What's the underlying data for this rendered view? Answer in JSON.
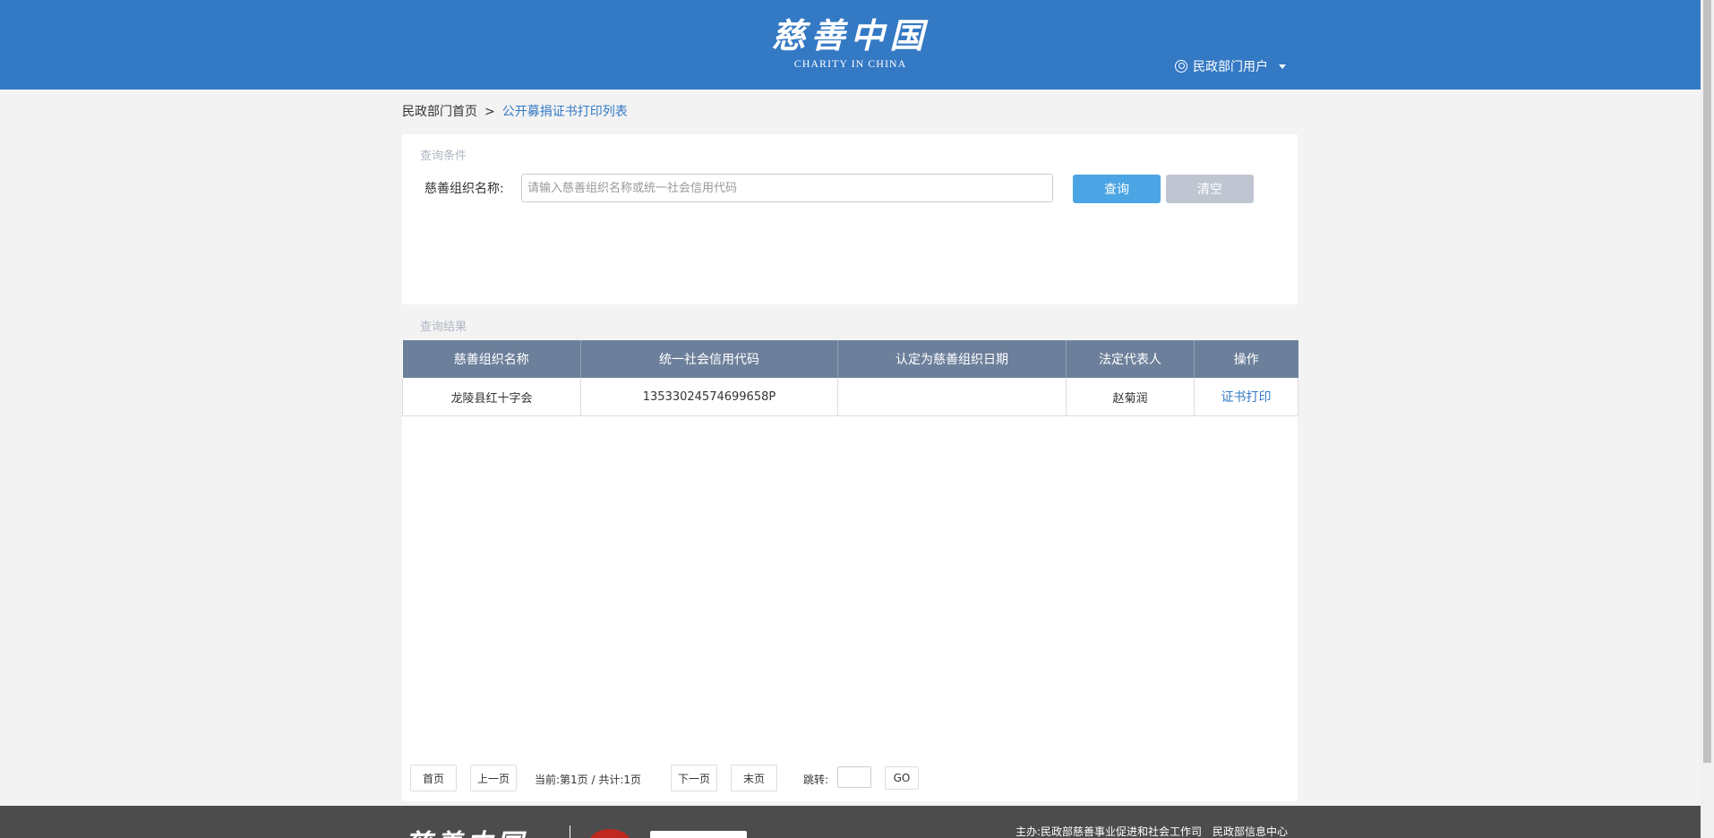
{
  "header": {
    "logo_cn": "慈善中国",
    "logo_en": "CHARITY IN CHINA",
    "user_label": "民政部门用户"
  },
  "breadcrumb": {
    "home": "民政部门首页",
    "separator": ">",
    "current": "公开募捐证书打印列表"
  },
  "query": {
    "title": "查询条件",
    "field_label": "慈善组织名称:",
    "placeholder": "请输入慈善组织名称或统一社会信用代码",
    "search_button": "查询",
    "clear_button": "清空"
  },
  "results": {
    "title": "查询结果",
    "columns": [
      "慈善组织名称",
      "统一社会信用代码",
      "认定为慈善组织日期",
      "法定代表人",
      "操作"
    ],
    "rows": [
      {
        "name": "龙陵县红十字会",
        "credit_code": "13533024574699658P",
        "date": "",
        "legal_rep": "赵菊润",
        "action": "证书打印"
      }
    ]
  },
  "pager": {
    "first": "首页",
    "prev": "上一页",
    "info": "当前:第1页 / 共计:1页",
    "next": "下一页",
    "last": "末页",
    "jump_label": "跳转:",
    "go": "GO"
  },
  "footer": {
    "logo": "慈善中国",
    "sponsor_prefix": "主办:民政部慈善事业促进和社会工作司",
    "sponsor_2": "民政部信息中心"
  },
  "colors": {
    "header_bg": "#3479c4",
    "table_header_bg": "#6d809b",
    "search_button": "#4ba5e4",
    "clear_button": "#bfc6d1",
    "link": "#3479c4"
  }
}
